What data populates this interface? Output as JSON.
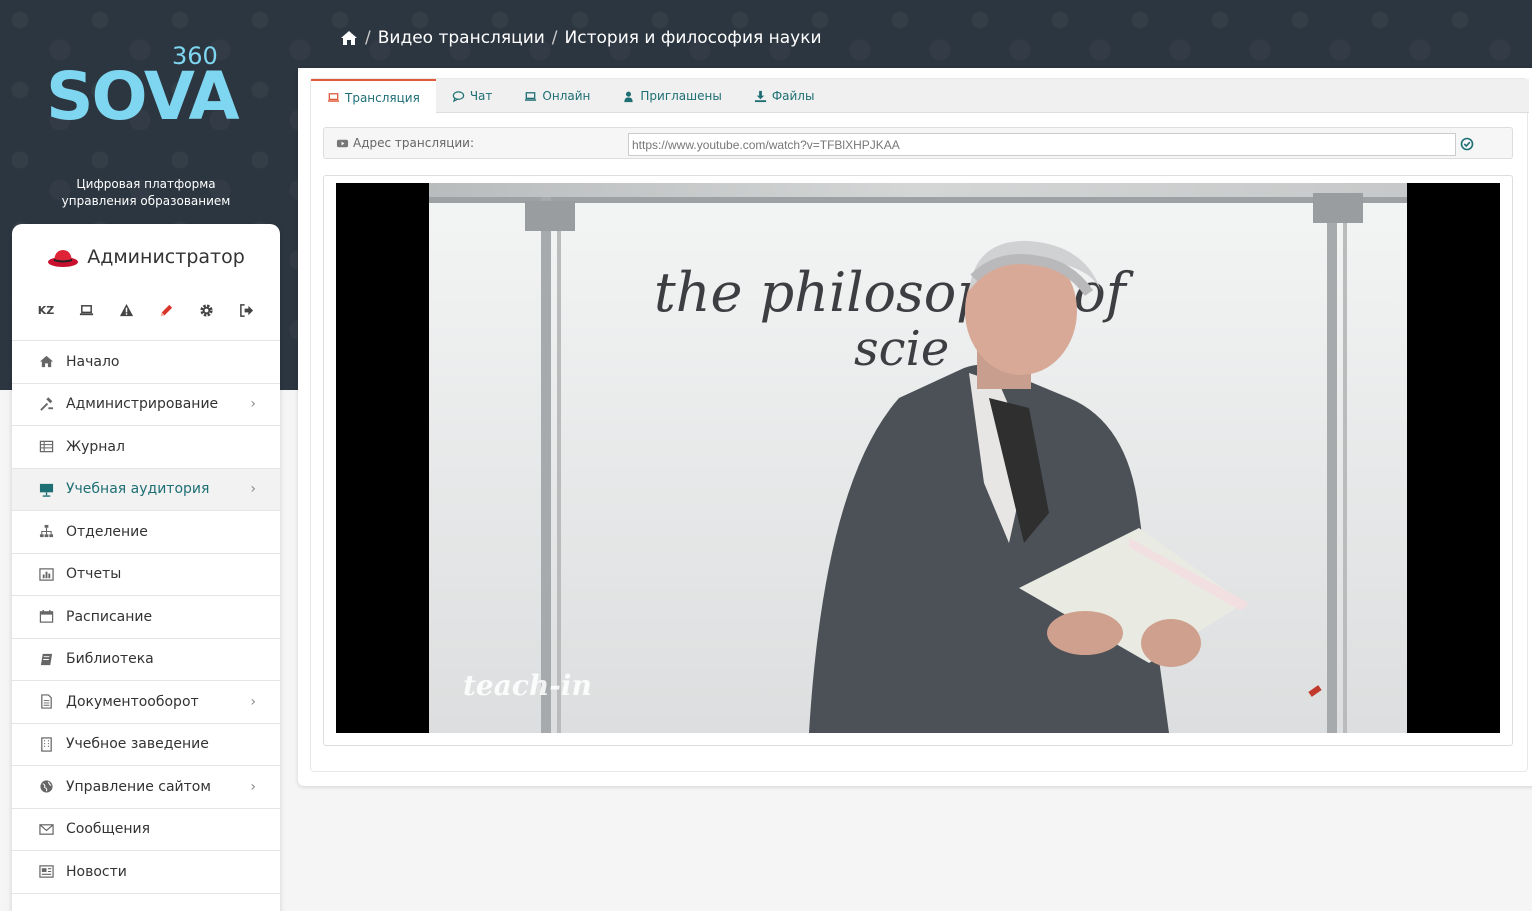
{
  "brand": {
    "logo_text": "SOVA",
    "logo_suffix": "360",
    "tagline_line1": "Цифровая платформа",
    "tagline_line2": "управления образованием"
  },
  "breadcrumb": {
    "items": [
      "Видео трансляции",
      "История и философия науки"
    ],
    "separator": "/"
  },
  "user": {
    "name": "Администратор"
  },
  "tools": {
    "lang": "KZ"
  },
  "menu": [
    {
      "label": "Начало",
      "icon": "home-icon",
      "submenu": false
    },
    {
      "label": "Администрирование",
      "icon": "admin-icon",
      "submenu": true
    },
    {
      "label": "Журнал",
      "icon": "table-icon",
      "submenu": false
    },
    {
      "label": "Учебная аудитория",
      "icon": "classroom-icon",
      "submenu": true,
      "active": true
    },
    {
      "label": "Отделение",
      "icon": "sitemap-icon",
      "submenu": false
    },
    {
      "label": "Отчеты",
      "icon": "bar-chart-icon",
      "submenu": false
    },
    {
      "label": "Расписание",
      "icon": "calendar-icon",
      "submenu": false
    },
    {
      "label": "Библиотека",
      "icon": "book-icon",
      "submenu": false
    },
    {
      "label": "Документооборот",
      "icon": "document-icon",
      "submenu": true
    },
    {
      "label": "Учебное заведение",
      "icon": "building-icon",
      "submenu": false
    },
    {
      "label": "Управление сайтом",
      "icon": "globe-icon",
      "submenu": true
    },
    {
      "label": "Сообщения",
      "icon": "envelope-icon",
      "submenu": false
    },
    {
      "label": "Новости",
      "icon": "newspaper-icon",
      "submenu": false
    }
  ],
  "tabs": {
    "broadcast": "Трансляция",
    "chat": "Чат",
    "online": "Онлайн",
    "invited": "Приглашены",
    "files": "Файлы"
  },
  "stream": {
    "address_label": "Адрес трансляции:",
    "url": "https://www.youtube.com/watch?v=TFBlXHPJKAA"
  },
  "video": {
    "watermark": "teach-in",
    "board_text_line1": "the philosophy of",
    "board_text_line2": "scie"
  },
  "colors": {
    "accent": "#1e6f74",
    "tab_active_border": "#e05a3a",
    "header_bg": "#2c3640",
    "logo": "#7fd6f0"
  }
}
